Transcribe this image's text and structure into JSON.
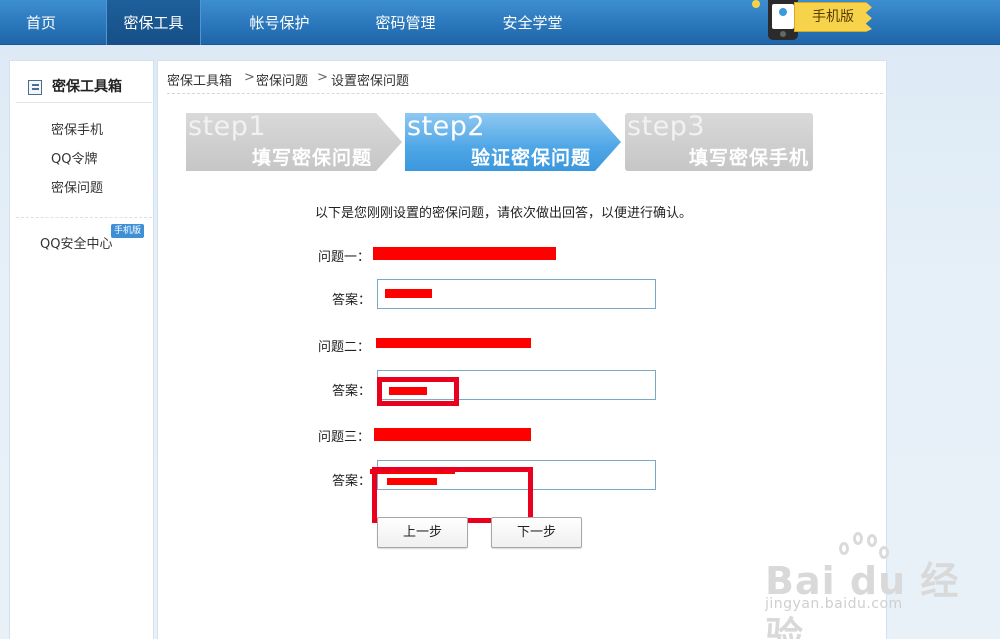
{
  "nav": {
    "items": [
      {
        "label": "首页",
        "active": false
      },
      {
        "label": "密保工具",
        "active": true
      },
      {
        "label": "帐号保护",
        "active": false
      },
      {
        "label": "密码管理",
        "active": false
      },
      {
        "label": "安全学堂",
        "active": false
      }
    ],
    "mobile_badge": "手机版",
    "icons": {
      "phone": "phone-icon"
    }
  },
  "sidebar": {
    "title": "密保工具箱",
    "title_icon": "toolbox-icon",
    "links": [
      "密保手机",
      "QQ令牌",
      "密保问题"
    ],
    "center_link": "QQ安全中心",
    "center_tag": "手机版"
  },
  "breadcrumb": {
    "items": [
      "密保工具箱",
      "密保问题",
      "设置密保问题"
    ],
    "separator": ">"
  },
  "steps": [
    {
      "num": "step1",
      "label": "填写密保问题",
      "state": "inactive"
    },
    {
      "num": "step2",
      "label": "验证密保问题",
      "state": "active"
    },
    {
      "num": "step3",
      "label": "填写密保手机",
      "state": "inactive"
    }
  ],
  "form": {
    "intro": "以下是您刚刚设置的密保问题，请依次做出回答，以便进行确认。",
    "questions": [
      {
        "label": "问题一：",
        "answer_label": "答案："
      },
      {
        "label": "问题二：",
        "answer_label": "答案："
      },
      {
        "label": "问题三：",
        "answer_label": "答案："
      }
    ],
    "prev_button": "上一步",
    "next_button": "下一步"
  },
  "watermark": {
    "logo": "Bai du 经验",
    "url": "jingyan.baidu.com"
  },
  "colors": {
    "nav_bg": "#2b77bb",
    "nav_active": "#164f86",
    "step_active": "#4ea6e6",
    "step_inactive": "#c6c6c6",
    "redaction": "#ff0000",
    "input_border": "#7aa8c7"
  }
}
